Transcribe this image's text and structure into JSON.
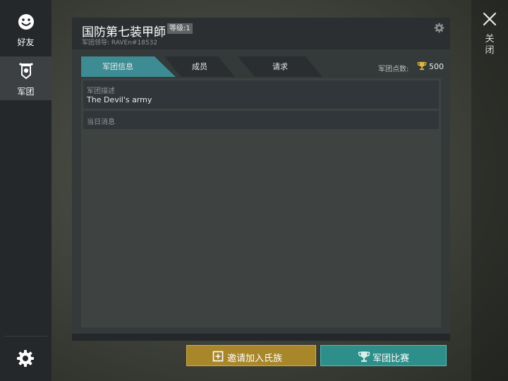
{
  "sidebar": {
    "items": [
      {
        "label": "好友",
        "icon": "smiley-face-icon",
        "active": false
      },
      {
        "label": "军团",
        "icon": "guild-banner-icon",
        "active": true
      }
    ],
    "settings_icon": "gear-icon"
  },
  "close": {
    "label": "关闭",
    "icon": "close-icon"
  },
  "guild": {
    "name": "国防第七装甲師",
    "level": "等级:1",
    "leader": "军团领导: RAVEn#18532",
    "settings_icon": "gear-icon"
  },
  "tabs": [
    {
      "label": "军团信息",
      "active": true
    },
    {
      "label": "成员",
      "active": false
    },
    {
      "label": "请求",
      "active": false
    }
  ],
  "points": {
    "label": "军团点数:",
    "value": "500",
    "icon": "trophy-icon"
  },
  "description": {
    "label": "军团描述",
    "value": "The Devil's army"
  },
  "daily_message": {
    "label": "当日消息",
    "value": ""
  },
  "buttons": {
    "invite": {
      "label": "邀请加入氏族",
      "icon": "plus-square-icon"
    },
    "competition": {
      "label": "军团比赛",
      "icon": "trophy-icon"
    }
  },
  "colors": {
    "tab_active": "#3d8c94",
    "invite_button": "#a8862a",
    "competition_button": "#2d8e8a",
    "trophy_gold": "#e0b640"
  }
}
